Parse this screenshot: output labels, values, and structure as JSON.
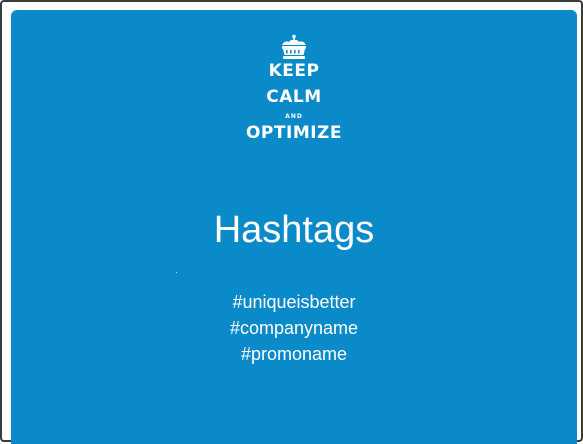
{
  "logo": {
    "icon": "crown-icon",
    "line1": "KEEP",
    "line2": "CALM",
    "line3": "AND",
    "line4": "OPTIMIZE"
  },
  "slide": {
    "title": "Hashtags",
    "tags": [
      "#uniqueisbetter",
      "#companyname",
      "#promoname"
    ]
  },
  "colors": {
    "background": "#0a8ac9",
    "text": "#ffffff",
    "frame": "#3a3a3a"
  }
}
